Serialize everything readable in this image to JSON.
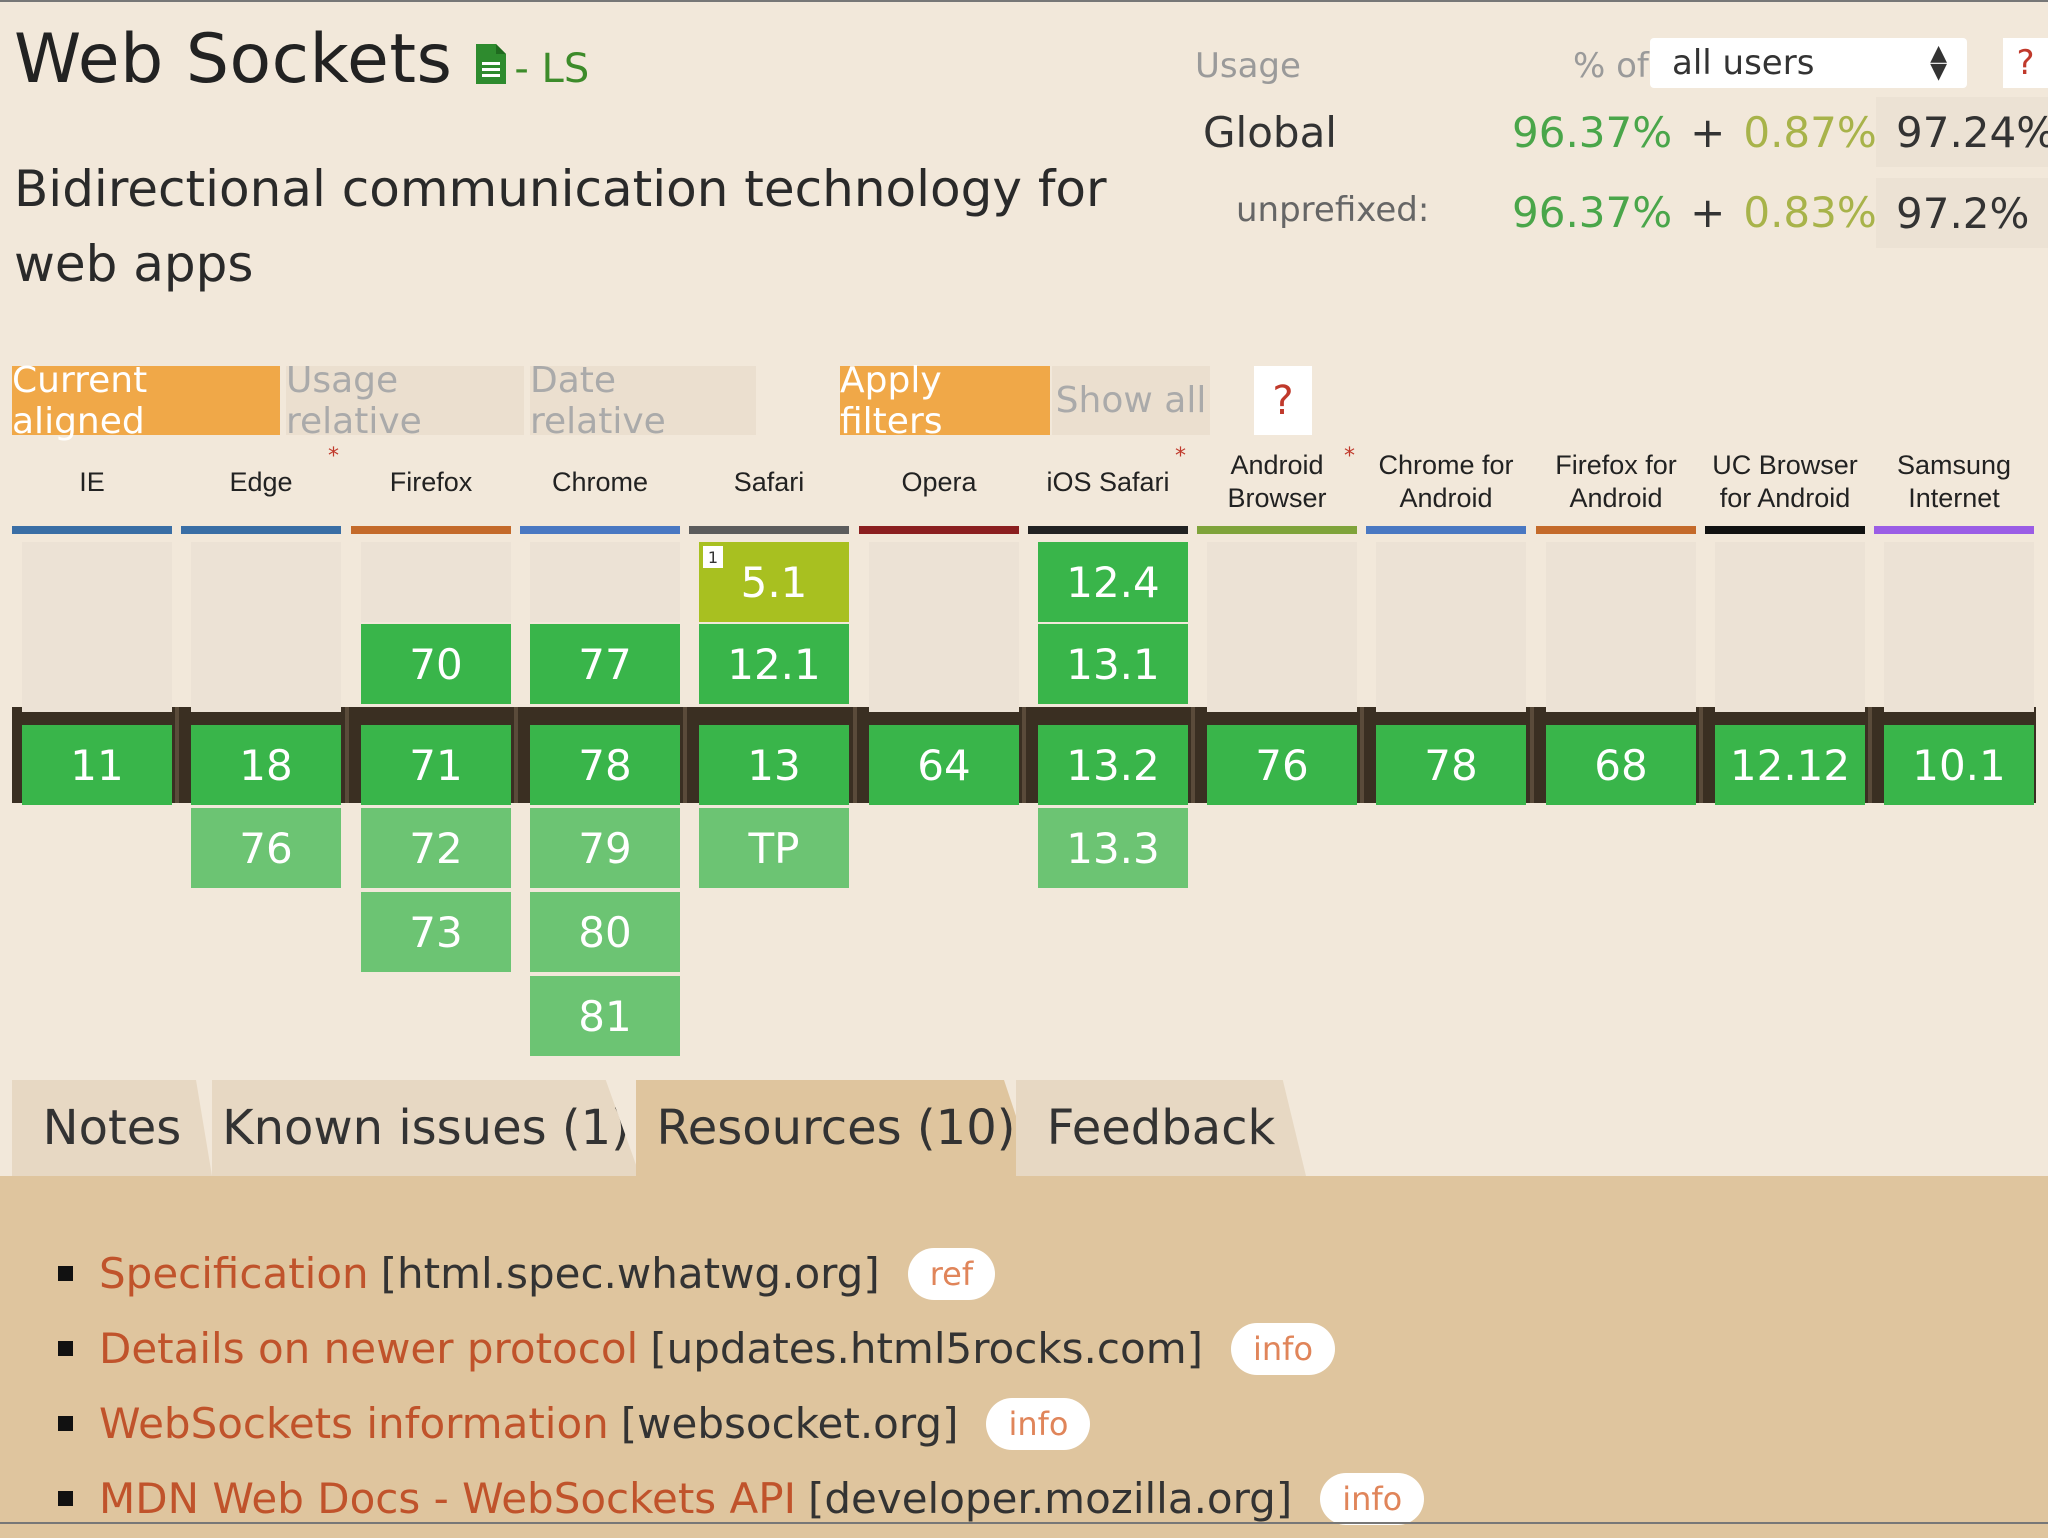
{
  "feature": {
    "title": "Web Sockets",
    "status": "- LS",
    "description": "Bidirectional communication technology for web apps"
  },
  "usage": {
    "label": "Usage",
    "pct_of": "% of",
    "users_option": "all users",
    "help": "?",
    "global": {
      "label": "Global",
      "full": "96.37%",
      "plus": "+",
      "partial": "0.87%",
      "equals": "=",
      "total": "97.24%"
    },
    "unprefixed": {
      "label": "unprefixed:",
      "full": "96.37%",
      "plus": "+",
      "partial": "0.83%",
      "equals": "=",
      "total": "97.2%"
    }
  },
  "filters": {
    "current_aligned": "Current aligned",
    "usage_relative": "Usage relative",
    "date_relative": "Date relative",
    "apply_filters": "Apply filters",
    "show_all": "Show all",
    "help": "?"
  },
  "browsers": [
    {
      "name": "IE",
      "color": "#3a6ea5",
      "star": "",
      "cells": [
        {
          "v": "",
          "t": "empty2"
        },
        {
          "v": "11",
          "t": "current"
        }
      ]
    },
    {
      "name": "Edge",
      "color": "#3a6ea5",
      "star": "*",
      "cells": [
        {
          "v": "",
          "t": "empty2"
        },
        {
          "v": "18",
          "t": "current"
        },
        {
          "v": "76",
          "t": "future"
        }
      ]
    },
    {
      "name": "Firefox",
      "color": "#c46a2a",
      "star": "",
      "cells": [
        {
          "v": "",
          "t": "empty1"
        },
        {
          "v": "70",
          "t": "past"
        },
        {
          "v": "71",
          "t": "current"
        },
        {
          "v": "72",
          "t": "future"
        },
        {
          "v": "73",
          "t": "future"
        }
      ]
    },
    {
      "name": "Chrome",
      "color": "#4a78c2",
      "star": "",
      "cells": [
        {
          "v": "",
          "t": "empty1"
        },
        {
          "v": "77",
          "t": "past"
        },
        {
          "v": "78",
          "t": "current"
        },
        {
          "v": "79",
          "t": "future"
        },
        {
          "v": "80",
          "t": "future"
        },
        {
          "v": "81",
          "t": "future"
        }
      ]
    },
    {
      "name": "Safari",
      "color": "#5c5c5c",
      "star": "",
      "cells": [
        {
          "v": "5.1",
          "t": "partial",
          "note": "1"
        },
        {
          "v": "12.1",
          "t": "past"
        },
        {
          "v": "13",
          "t": "current"
        },
        {
          "v": "TP",
          "t": "future"
        }
      ]
    },
    {
      "name": "Opera",
      "color": "#8b1f1f",
      "star": "",
      "cells": [
        {
          "v": "",
          "t": "empty2"
        },
        {
          "v": "64",
          "t": "current"
        }
      ]
    },
    {
      "name": "iOS Safari",
      "color": "#222222",
      "star": "*",
      "cells": [
        {
          "v": "12.4",
          "t": "past"
        },
        {
          "v": "13.1",
          "t": "past"
        },
        {
          "v": "13.2",
          "t": "current"
        },
        {
          "v": "13.3",
          "t": "future"
        }
      ]
    },
    {
      "name": "Android Browser",
      "color": "#7fa33a",
      "star": "*",
      "cells": [
        {
          "v": "",
          "t": "empty2"
        },
        {
          "v": "76",
          "t": "current"
        }
      ]
    },
    {
      "name": "Chrome for Android",
      "color": "#4a78c2",
      "star": "",
      "cells": [
        {
          "v": "",
          "t": "empty2"
        },
        {
          "v": "78",
          "t": "current"
        }
      ]
    },
    {
      "name": "Firefox for Android",
      "color": "#c46a2a",
      "star": "",
      "cells": [
        {
          "v": "",
          "t": "empty2"
        },
        {
          "v": "68",
          "t": "current"
        }
      ]
    },
    {
      "name": "UC Browser for Android",
      "color": "#111111",
      "star": "",
      "cells": [
        {
          "v": "",
          "t": "empty2"
        },
        {
          "v": "12.12",
          "t": "current"
        }
      ]
    },
    {
      "name": "Samsung Internet",
      "color": "#9b5de5",
      "star": "",
      "cells": [
        {
          "v": "",
          "t": "empty2"
        },
        {
          "v": "10.1",
          "t": "current"
        }
      ]
    }
  ],
  "tabs": {
    "notes": "Notes",
    "known_issues": "Known issues (1)",
    "resources": "Resources (10)",
    "feedback": "Feedback"
  },
  "resources": [
    {
      "link": "Specification",
      "domain": "[html.spec.whatwg.org]",
      "badge": "ref"
    },
    {
      "link": "Details on newer protocol",
      "domain": "[updates.html5rocks.com]",
      "badge": "info"
    },
    {
      "link": "WebSockets information",
      "domain": "[websocket.org]",
      "badge": "info"
    },
    {
      "link": "MDN Web Docs - WebSockets API",
      "domain": "[developer.mozilla.org]",
      "badge": "info"
    }
  ],
  "colors": {
    "background": "#f2e8da",
    "supported": "#39b54a",
    "future_supported": "#6cc473",
    "partial": "#a8c020",
    "accent": "#f0a848",
    "link": "#c0532b"
  }
}
